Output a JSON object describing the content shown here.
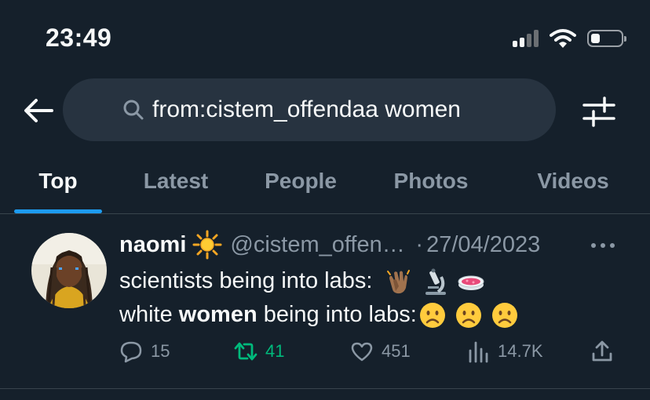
{
  "status_bar": {
    "time": "23:49"
  },
  "search": {
    "query": "from:cistem_offendaa women"
  },
  "tabs": [
    {
      "label": "Top",
      "active": true
    },
    {
      "label": "Latest",
      "active": false
    },
    {
      "label": "People",
      "active": false
    },
    {
      "label": "Photos",
      "active": false
    },
    {
      "label": "Videos",
      "active": false
    }
  ],
  "tweet": {
    "display_name": "naomi",
    "handle": "@cistem_offendaa",
    "separator": "·",
    "date": "27/04/2023",
    "line1_text": "scientists being into labs:",
    "line2_before": "white ",
    "line2_bold": "women",
    "line2_after": " being into labs:",
    "line1_emojis": [
      "clapping-hands-icon",
      "microscope-icon",
      "petri-dish-icon"
    ],
    "line2_emojis": [
      "frowning-face-icon",
      "frowning-face-icon",
      "frowning-face-icon"
    ],
    "stats": {
      "replies": "15",
      "retweets": "41",
      "likes": "451",
      "views": "14.7K"
    }
  },
  "colors": {
    "background": "#15202b",
    "search_bg": "#273340",
    "accent": "#1d9bf0",
    "muted": "#8b98a5",
    "retweet": "#00ba7c",
    "divider": "#38444d"
  }
}
